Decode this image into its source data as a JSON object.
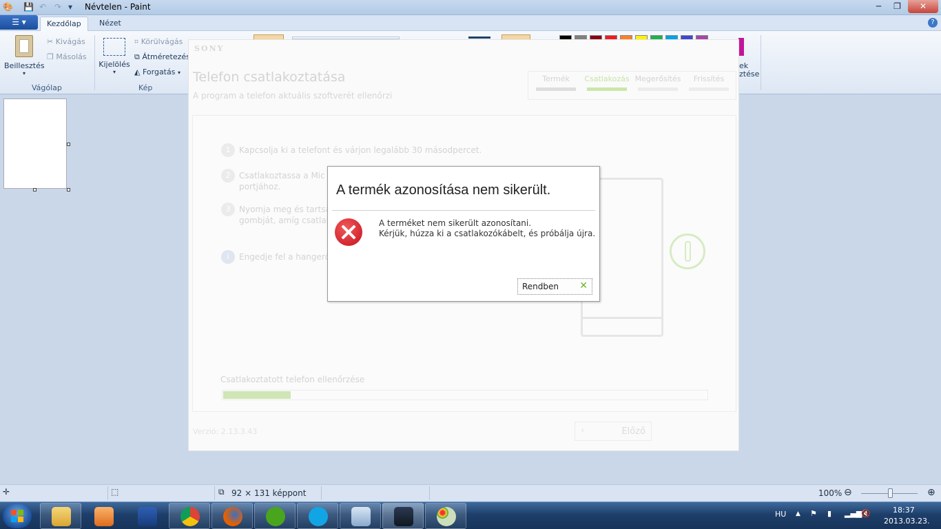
{
  "window": {
    "title": "Névtelen - Paint"
  },
  "ribbon": {
    "tabs": [
      "Kezdőlap",
      "Nézet"
    ],
    "clipboard": {
      "paste": "Beillesztés",
      "cut": "Kivágás",
      "copy": "Másolás",
      "group": "Vágólap"
    },
    "image": {
      "select": "Kijelölés",
      "crop": "Körülvágás",
      "resize": "Átméretezés",
      "rotate": "Forgatás",
      "group": "Kép"
    },
    "colors_edit_fragment": [
      "ek",
      "ztése"
    ],
    "palette": [
      "#000000",
      "#7f7f7f",
      "#880015",
      "#ed1c24",
      "#ff7f27",
      "#fff200",
      "#22b14c",
      "#00a2e8",
      "#3f48cc",
      "#a349a4"
    ]
  },
  "statusbar": {
    "canvas_size": "92 × 131 képpont",
    "zoom": "100%"
  },
  "sony_app": {
    "brand": "SONY",
    "title": "Telefon csatlakoztatása",
    "subtitle": "A program a telefon aktuális szoftverét ellenőrzi",
    "steps": [
      "Termék",
      "Csatlakozás",
      "Megerősítés",
      "Frissítés"
    ],
    "instructions": [
      {
        "num": "1",
        "text": "Kapcsolja ki a telefont és várjon legalább 30 másodpercet."
      },
      {
        "num": "2",
        "text_line1": "Csatlakoztassa a Mic",
        "text_line2": "portjához."
      },
      {
        "num": "3",
        "text_line1": "Nyomja meg és tartsa",
        "text_line2": "gombját, amíg csatlak"
      },
      {
        "num": "i",
        "text": "Engedje fel a hangerő"
      }
    ],
    "check_label": "Csatlakoztatott telefon ellenőrzése",
    "progress": 0.14,
    "version": "Verzió: 2.13.3.43",
    "prev_button": "Előző"
  },
  "dialog": {
    "title": "A termék azonosítása nem sikerült.",
    "message_line1": "A terméket nem sikerült azonosítani.",
    "message_line2": "Kérjük, húzza ki a csatlakozókábelt, és próbálja újra.",
    "ok_button": "Rendben"
  },
  "tray": {
    "language": "HU",
    "time": "18:37",
    "date": "2013.03.23."
  }
}
